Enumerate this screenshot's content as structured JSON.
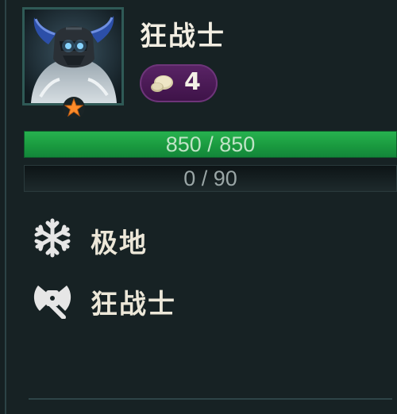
{
  "unit": {
    "name": "狂战士",
    "portrait_icon": "horned-warrior-portrait",
    "star_icon": "star-icon",
    "star_color": "#ff8c2a"
  },
  "cost": {
    "icon": "coin-icon",
    "value": "4",
    "pill_color": "#4b1a57"
  },
  "health": {
    "text": "850 / 850",
    "current": 850,
    "max": 850,
    "color": "#1fa346"
  },
  "mana": {
    "text": "0 / 90",
    "current": 0,
    "max": 90
  },
  "traits": [
    {
      "icon": "snowflake-icon",
      "label": "极地"
    },
    {
      "icon": "battle-axe-icon",
      "label": "狂战士"
    }
  ]
}
